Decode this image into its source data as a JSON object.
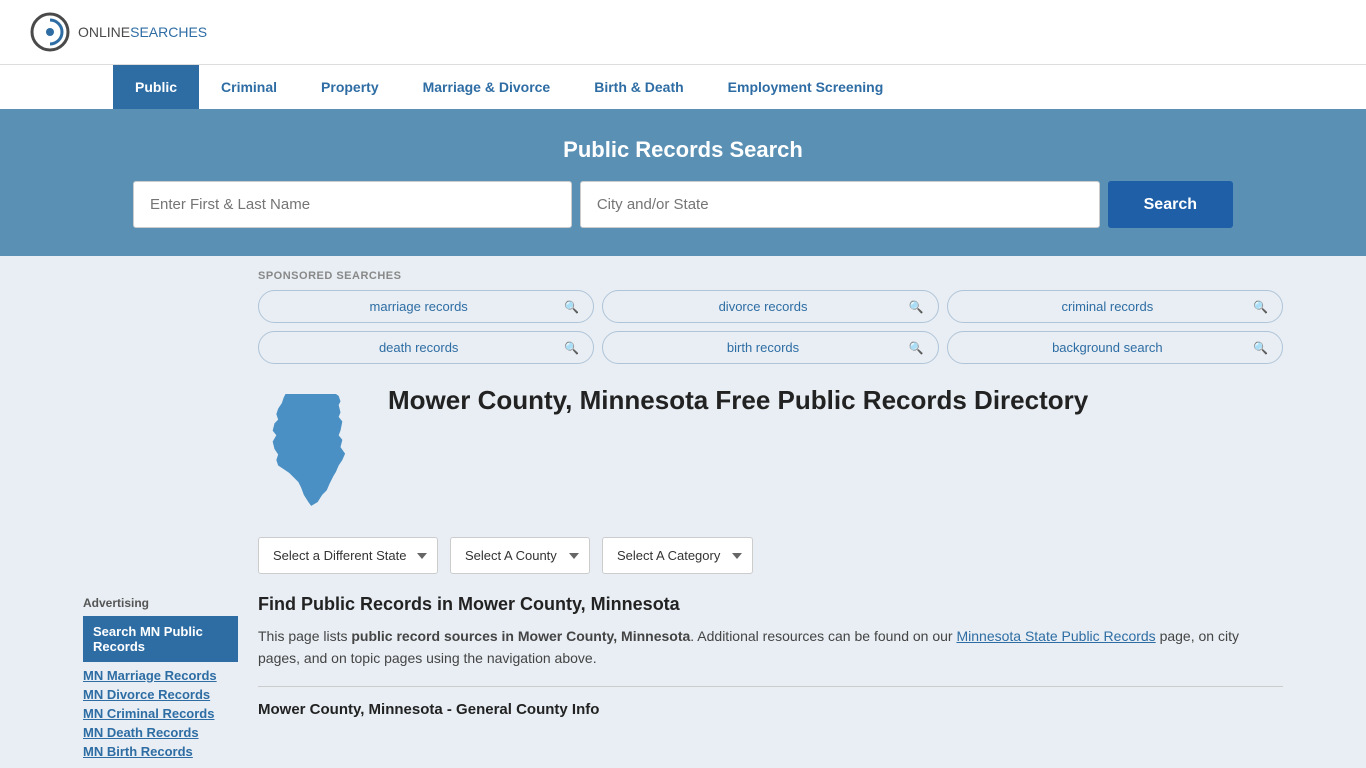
{
  "header": {
    "logo_online": "ONLINE",
    "logo_searches": "SEARCHES"
  },
  "nav": {
    "items": [
      {
        "label": "Public",
        "active": true
      },
      {
        "label": "Criminal",
        "active": false
      },
      {
        "label": "Property",
        "active": false
      },
      {
        "label": "Marriage & Divorce",
        "active": false
      },
      {
        "label": "Birth & Death",
        "active": false
      },
      {
        "label": "Employment Screening",
        "active": false
      }
    ]
  },
  "hero": {
    "title": "Public Records Search",
    "name_placeholder": "Enter First & Last Name",
    "location_placeholder": "City and/or State",
    "search_button": "Search"
  },
  "sponsored": {
    "label": "SPONSORED SEARCHES",
    "tags": [
      {
        "text": "marriage records"
      },
      {
        "text": "divorce records"
      },
      {
        "text": "criminal records"
      },
      {
        "text": "death records"
      },
      {
        "text": "birth records"
      },
      {
        "text": "background search"
      }
    ]
  },
  "sidebar": {
    "ad_label": "Advertising",
    "highlighted_link": "Search MN Public Records",
    "links": [
      "MN Marriage Records",
      "MN Divorce Records",
      "MN Criminal Records",
      "MN Death Records",
      "MN Birth Records"
    ]
  },
  "page": {
    "title": "Mower County, Minnesota Free Public Records Directory",
    "dropdowns": {
      "state": "Select a Different State",
      "county": "Select A County",
      "category": "Select A Category"
    },
    "find_title": "Find Public Records in Mower County, Minnesota",
    "find_text_plain": "This page lists ",
    "find_text_bold": "public record sources in Mower County, Minnesota",
    "find_text_mid": ". Additional resources can be found on our ",
    "find_link": "Minnesota State Public Records",
    "find_text_end": " page, on city pages, and on topic pages using the navigation above.",
    "general_info_title": "Mower County, Minnesota - General County Info"
  }
}
